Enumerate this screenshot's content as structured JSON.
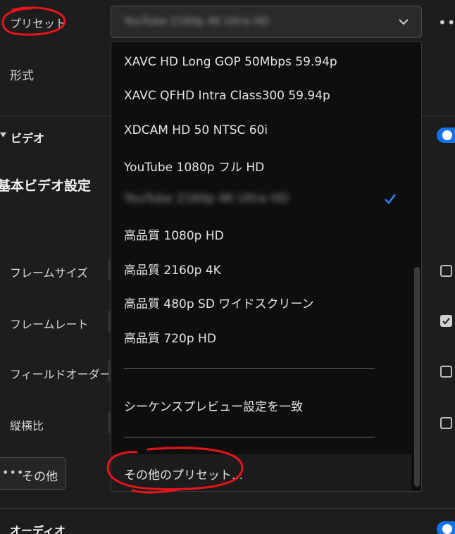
{
  "preset": {
    "label": "プリセット",
    "value": "YouTube 2160p 4K Ultra HD"
  },
  "format_label": "形式",
  "video": {
    "section_title": "ビデオ",
    "basic_settings_title": "基本ビデオ設定",
    "fields": [
      {
        "label": "フレームサイズ"
      },
      {
        "label": "フレームレート"
      },
      {
        "label": "フィールドオーダー"
      },
      {
        "label": "縦横比"
      }
    ],
    "other_button": "その他"
  },
  "audio": {
    "section_title": "オーディオ"
  },
  "dropdown": {
    "items": [
      "XAVC HD Long GOP 50Mbps 59.94p",
      "XAVC QFHD Intra Class300 59.94p",
      "XDCAM HD 50 NTSC 60i",
      "YouTube 1080p フル HD",
      "YouTube 2160p 4K Ultra HD",
      "高品質 1080p HD",
      "高品質 2160p 4K",
      "高品質 480p SD ワイドスクリーン",
      "高品質 720p HD"
    ],
    "selected_index": 4,
    "match_sequence": "シーケンスプレビュー設定を一致",
    "more_presets": "その他のプリセット..."
  },
  "colors": {
    "accent": "#1473e6",
    "annotation": "#e8141b"
  }
}
